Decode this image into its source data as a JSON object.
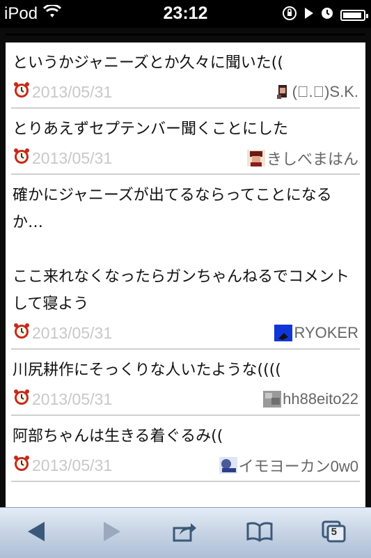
{
  "status_bar": {
    "carrier": "iPod",
    "time": "23:12"
  },
  "posts": [
    {
      "text": "というかジャニーズとか久々に聞いた((",
      "date": "2013/05/31",
      "author": "(ﾟ.ﾟ)S.K."
    },
    {
      "text": "とりあえずセプテンバー聞くことにした",
      "date": "2013/05/31",
      "author": "きしべまはん"
    },
    {
      "text": "確かにジャニーズが出てるならってことになるか…\n\nここ来れなくなったらガンちゃんねるでコメントして寝よう",
      "date": "2013/05/31",
      "author": "RYOKER"
    },
    {
      "text": "川尻耕作にそっくりな人いたような((((",
      "date": "2013/05/31",
      "author": "hh88eito22"
    },
    {
      "text": "阿部ちゃんは生きる着ぐるみ((",
      "date": "2013/05/31",
      "author": "イモヨーカン0w0"
    }
  ],
  "toolbar": {
    "tab_count": "5"
  },
  "colors": {
    "accent": "#2d66c8",
    "toolbar": "#c6d3e4",
    "date_text": "#c8c8c8"
  },
  "icons": [
    "wifi-icon",
    "orientation-lock-icon",
    "play-icon",
    "alarm-icon",
    "battery-icon",
    "back-icon",
    "forward-icon",
    "share-icon",
    "bookmarks-icon",
    "tabs-icon"
  ]
}
